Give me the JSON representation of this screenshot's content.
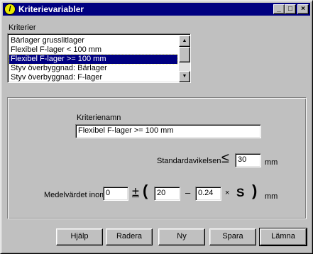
{
  "window": {
    "title": "Kriterievariabler",
    "icon": "app-logo-icon",
    "icon_glyph": "/",
    "controls": {
      "minimize": "_",
      "maximize": "□",
      "close": "×"
    }
  },
  "criteria": {
    "label": "Kriterier",
    "items": [
      "Bärlager grusslitlager",
      "Flexibel F-lager < 100 mm",
      "Flexibel F-lager >= 100 mm",
      "Styv överbyggnad: Bärlager",
      "Styv överbyggnad: F-lager"
    ],
    "selected_index": 2,
    "scroll_up": "▲",
    "scroll_down": "▼"
  },
  "form": {
    "name_label": "Kriterienamn",
    "name_value": "Flexibel F-lager >= 100 mm",
    "std_label": "Standardavikelsen",
    "std_operator": "≤",
    "std_value": "30",
    "std_unit": "mm",
    "mean_label": "Medelvärdet inom",
    "mean_value": "0",
    "plus_minus": "±",
    "paren_open": "(",
    "coef_a": "20",
    "minus": "–",
    "coef_b": "0.24",
    "times": "×",
    "s_symbol": "S",
    "paren_close": ")",
    "mean_unit": "mm"
  },
  "buttons": {
    "help": "Hjälp",
    "delete": "Radera",
    "new": "Ny",
    "save": "Spara",
    "close": "Lämna"
  }
}
